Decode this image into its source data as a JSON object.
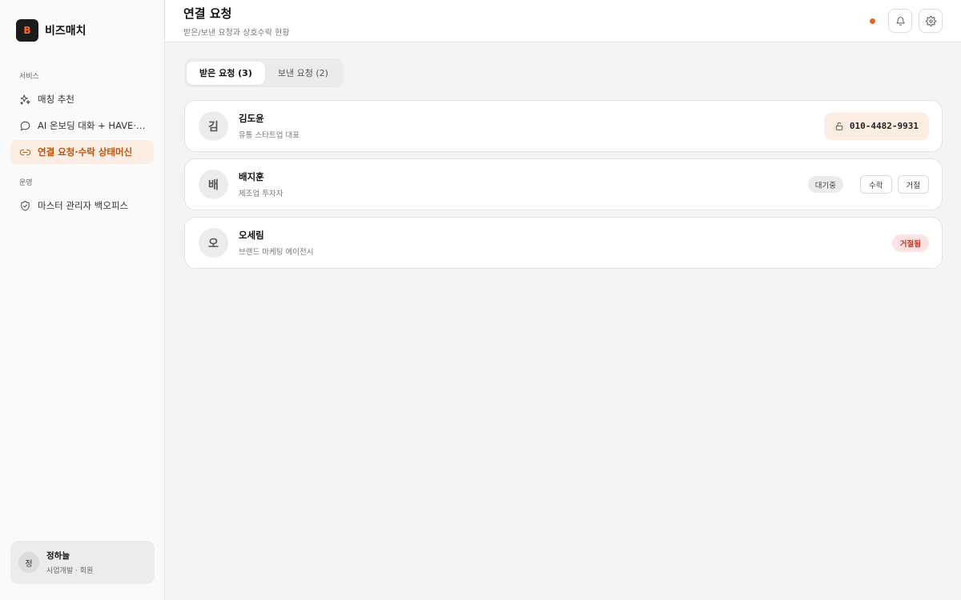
{
  "app": {
    "logo_letter": "B",
    "name": "비즈매치",
    "accent_color": "#e8651c"
  },
  "sidebar": {
    "sections": [
      {
        "label": "서비스",
        "items": [
          {
            "label": "매칭 추천",
            "icon": "sparkles-icon",
            "active": false
          },
          {
            "label": "AI 온보딩 대화 + HAVE·W...",
            "icon": "chat-bubble-icon",
            "active": false
          },
          {
            "label": "연결 요청·수락 상태머신",
            "icon": "link-icon",
            "active": true
          }
        ]
      },
      {
        "label": "운영",
        "items": [
          {
            "label": "마스터 관리자 백오피스",
            "icon": "shield-check-icon",
            "active": false
          }
        ]
      }
    ],
    "user": {
      "avatar_letter": "정",
      "name": "정하늘",
      "role": "사업개발 · 회원"
    }
  },
  "header": {
    "title": "연결 요청",
    "subtitle": "받은/보낸 요청과 상호수락 현황",
    "notification_icon": "bell-icon",
    "settings_icon": "gear-icon"
  },
  "tabs": [
    {
      "label": "받은 요청 (3)",
      "active": true
    },
    {
      "label": "보낸 요청 (2)",
      "active": false
    }
  ],
  "requests": [
    {
      "avatar_letter": "김",
      "name": "김도윤",
      "description": "유통 스타트업 대표",
      "status": "accepted",
      "phone": "010-4482-9931",
      "phone_icon": "unlock-icon"
    },
    {
      "avatar_letter": "배",
      "name": "배지훈",
      "description": "제조업 투자자",
      "status": "pending",
      "status_label": "대기중",
      "accept_label": "수락",
      "reject_label": "거절"
    },
    {
      "avatar_letter": "오",
      "name": "오세림",
      "description": "브랜드 마케팅 에이전시",
      "status": "rejected",
      "status_label": "거절됨"
    }
  ]
}
